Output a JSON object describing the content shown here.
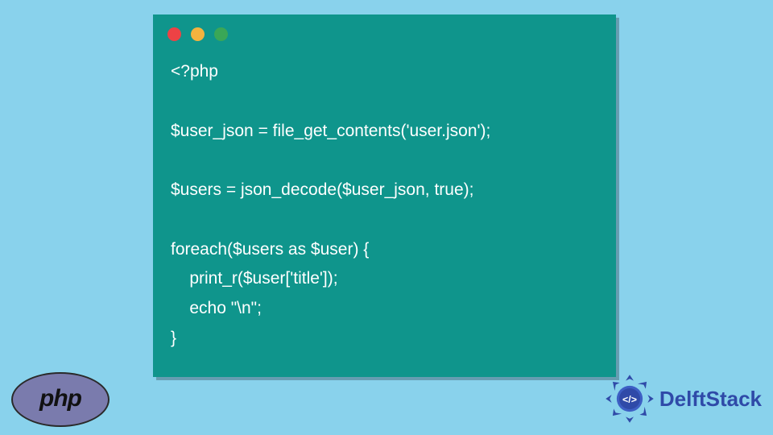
{
  "code": {
    "lines": [
      "<?php",
      "",
      "$user_json = file_get_contents('user.json');",
      "",
      "$users = json_decode($user_json, true);",
      "",
      "foreach($users as $user) {",
      "    print_r($user['title']);",
      "    echo \"\\n\";",
      "}"
    ]
  },
  "window": {
    "traffic_lights": [
      "red",
      "yellow",
      "green"
    ]
  },
  "logos": {
    "php_label": "php",
    "delft_label": "DelftStack",
    "delft_badge_text": "</>"
  },
  "colors": {
    "page_bg": "#89d2ec",
    "window_bg": "#0f958c",
    "code_text": "#ffffff",
    "php_ellipse": "#7a7bad",
    "delft_primary": "#2f4aa8"
  }
}
